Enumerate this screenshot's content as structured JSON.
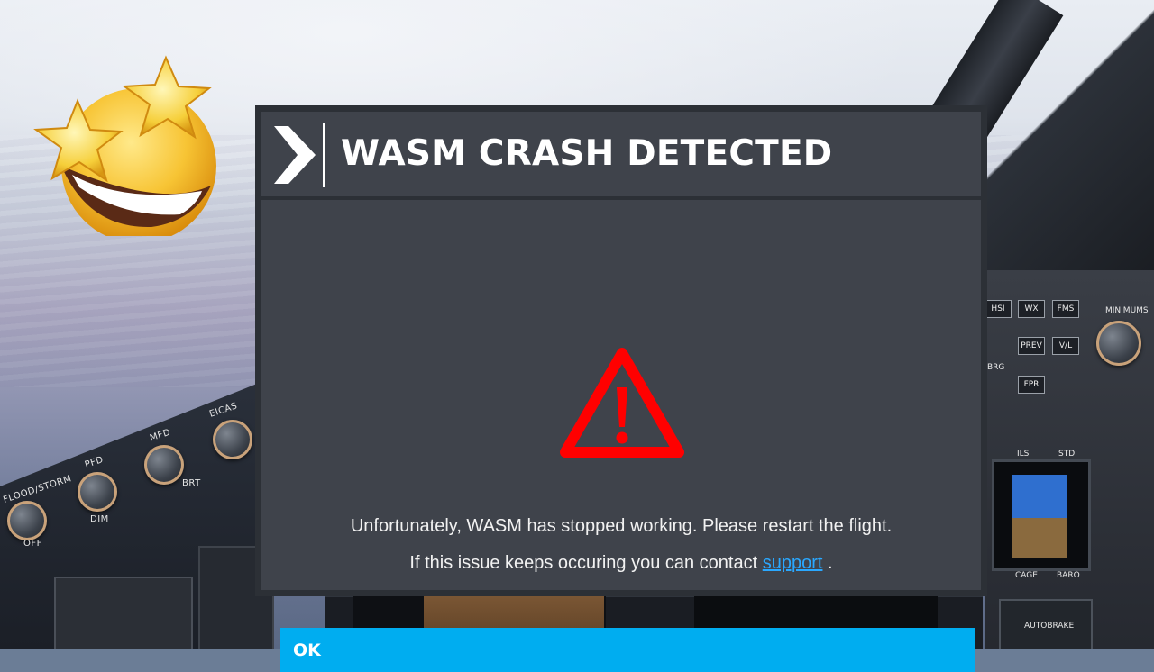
{
  "dialog": {
    "title": "WASM CRASH DETECTED",
    "header_icon": "chevron-right-icon",
    "status_icon": "warning-triangle-icon",
    "message_line1": "Unfortunately, WASM has stopped working. Please restart the flight.",
    "message_line2_prefix": "If this issue keeps occuring you can contact ",
    "message_line2_link": "support",
    "message_line2_suffix": " .",
    "ok_label": "OK"
  },
  "colors": {
    "dialog_bg": "#3f434b",
    "frame_bg": "#2c3036",
    "accent_button": "#00adf0",
    "link": "#2aa8ff",
    "warning": "#ff0000"
  },
  "overlay": {
    "emoji": "star-struck-emoji-icon"
  },
  "cockpit": {
    "left_knobs": [
      "FLOOD/STORM",
      "PFD",
      "MFD",
      "EICAS"
    ],
    "knob_scale_left": "DIM",
    "knob_scale_right": "BRT",
    "knob_off": "OFF",
    "right_buttons": [
      "HSI",
      "WX",
      "FMS",
      "PREV",
      "V/L",
      "FPR"
    ],
    "right_labels": [
      "MINIMUMS",
      "BRG",
      "ILS",
      "STD",
      "CAGE",
      "BARO",
      "AUTOBRAKE"
    ]
  }
}
